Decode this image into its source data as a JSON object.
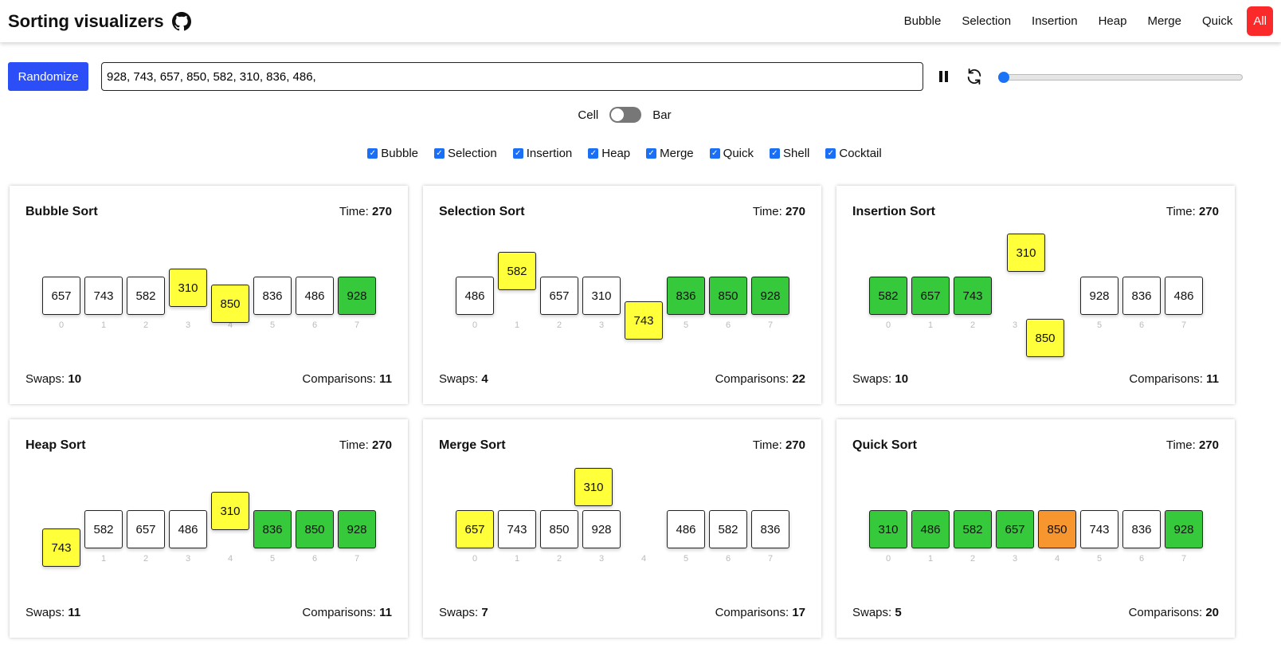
{
  "header": {
    "title": "Sorting visualizers",
    "nav": [
      "Bubble",
      "Selection",
      "Insertion",
      "Heap",
      "Merge",
      "Quick",
      "All"
    ],
    "active": "All"
  },
  "controls": {
    "randomize": "Randomize",
    "array_value": "928, 743, 657, 850, 582, 310, 836, 486,",
    "speed_percent": 0
  },
  "view_toggle": {
    "left": "Cell",
    "right": "Bar",
    "selected": "Cell"
  },
  "algorithms": [
    {
      "label": "Bubble",
      "checked": true
    },
    {
      "label": "Selection",
      "checked": true
    },
    {
      "label": "Insertion",
      "checked": true
    },
    {
      "label": "Heap",
      "checked": true
    },
    {
      "label": "Merge",
      "checked": true
    },
    {
      "label": "Quick",
      "checked": true
    },
    {
      "label": "Shell",
      "checked": true
    },
    {
      "label": "Cocktail",
      "checked": true
    }
  ],
  "colors": {
    "default": "#ffffff",
    "compare": "#ffff3a",
    "sorted": "#36c93c",
    "pivot": "#f7962f",
    "accent": "#2b4ef6",
    "active_nav": "#fb2a2a"
  },
  "labels": {
    "time": "Time:",
    "swaps": "Swaps:",
    "comparisons": "Comparisons:"
  },
  "panels": [
    {
      "name": "Bubble Sort",
      "time": "270",
      "swaps": "10",
      "comparisons": "11",
      "indices": [
        "0",
        "1",
        "2",
        "3",
        "4",
        "5",
        "6",
        "7"
      ],
      "cells": [
        {
          "v": "657",
          "s": "default"
        },
        {
          "v": "743",
          "s": "default"
        },
        {
          "v": "582",
          "s": "default"
        },
        {
          "v": "310",
          "s": "compare"
        },
        {
          "v": "850",
          "s": "compare"
        },
        {
          "v": "836",
          "s": "default"
        },
        {
          "v": "486",
          "s": "default"
        },
        {
          "v": "928",
          "s": "sorted"
        }
      ]
    },
    {
      "name": "Selection Sort",
      "time": "270",
      "swaps": "4",
      "comparisons": "22",
      "indices": [
        "0",
        "1",
        "2",
        "3",
        "4",
        "5",
        "6",
        "7"
      ],
      "cells": [
        {
          "v": "486",
          "s": "default"
        },
        {
          "v": "582",
          "s": "compare"
        },
        {
          "v": "657",
          "s": "default"
        },
        {
          "v": "310",
          "s": "default"
        },
        {
          "v": "743",
          "s": "compare"
        },
        {
          "v": "836",
          "s": "sorted"
        },
        {
          "v": "850",
          "s": "sorted"
        },
        {
          "v": "928",
          "s": "sorted"
        }
      ]
    },
    {
      "name": "Insertion Sort",
      "time": "270",
      "swaps": "10",
      "comparisons": "11",
      "indices": [
        "0",
        "1",
        "2",
        "3",
        "",
        "5",
        "6",
        "7"
      ],
      "cells": [
        {
          "v": "582",
          "s": "sorted"
        },
        {
          "v": "657",
          "s": "sorted"
        },
        {
          "v": "743",
          "s": "sorted"
        },
        {
          "v": "310",
          "s": "compare"
        },
        {
          "v": "850",
          "s": "compare"
        },
        {
          "v": "928",
          "s": "default"
        },
        {
          "v": "836",
          "s": "default"
        },
        {
          "v": "486",
          "s": "default"
        }
      ]
    },
    {
      "name": "Heap Sort",
      "time": "270",
      "swaps": "11",
      "comparisons": "11",
      "indices": [
        "0",
        "1",
        "2",
        "3",
        "4",
        "5",
        "6",
        "7"
      ],
      "cells": [
        {
          "v": "743",
          "s": "compare"
        },
        {
          "v": "582",
          "s": "default"
        },
        {
          "v": "657",
          "s": "default"
        },
        {
          "v": "486",
          "s": "default"
        },
        {
          "v": "310",
          "s": "compare"
        },
        {
          "v": "836",
          "s": "sorted"
        },
        {
          "v": "850",
          "s": "sorted"
        },
        {
          "v": "928",
          "s": "sorted"
        }
      ]
    },
    {
      "name": "Merge Sort",
      "time": "270",
      "swaps": "7",
      "comparisons": "17",
      "indices": [
        "0",
        "1",
        "2",
        "3",
        "4",
        "5",
        "6",
        "7"
      ],
      "cells": [
        {
          "v": "657",
          "s": "compare"
        },
        {
          "v": "743",
          "s": "default"
        },
        {
          "v": "850",
          "s": "default"
        },
        {
          "v": "928",
          "s": "default"
        },
        {
          "v": "310",
          "s": "compare"
        },
        {
          "v": "486",
          "s": "default"
        },
        {
          "v": "582",
          "s": "default"
        },
        {
          "v": "836",
          "s": "default"
        }
      ]
    },
    {
      "name": "Quick Sort",
      "time": "270",
      "swaps": "5",
      "comparisons": "20",
      "indices": [
        "0",
        "1",
        "2",
        "3",
        "4",
        "5",
        "6",
        "7"
      ],
      "cells": [
        {
          "v": "310",
          "s": "sorted"
        },
        {
          "v": "486",
          "s": "sorted"
        },
        {
          "v": "582",
          "s": "sorted"
        },
        {
          "v": "657",
          "s": "sorted"
        },
        {
          "v": "850",
          "s": "pivot"
        },
        {
          "v": "743",
          "s": "default"
        },
        {
          "v": "836",
          "s": "default"
        },
        {
          "v": "928",
          "s": "sorted"
        }
      ]
    }
  ]
}
